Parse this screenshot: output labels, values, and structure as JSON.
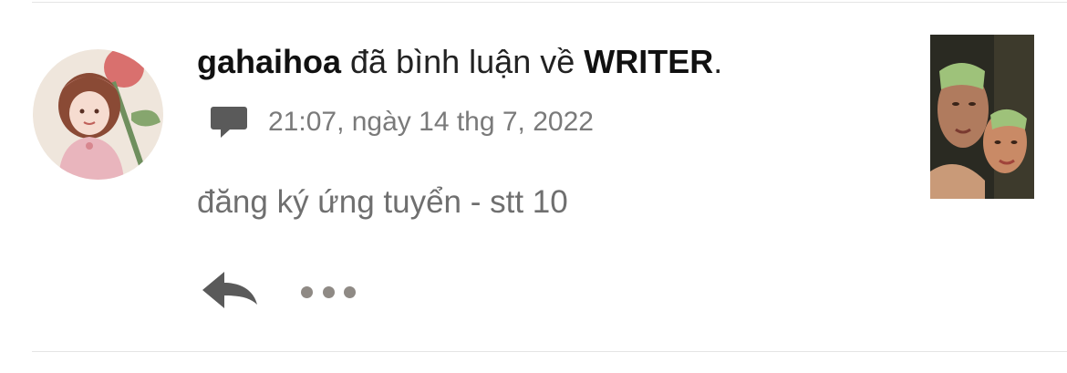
{
  "notification": {
    "username": "gahaihoa",
    "action_text": " đã bình luận về ",
    "story_title": "WRITER",
    "trailing": ".",
    "timestamp": "21:07, ngày 14 thg 7, 2022",
    "comment_text": "đăng ký ứng tuyển - stt 10"
  },
  "icons": {
    "comment": "speech-bubble-icon",
    "reply": "reply-arrow-icon",
    "more": "more-dots-icon"
  },
  "colors": {
    "meta_text": "#7a7a7a",
    "icon": "#5a5a5a",
    "dots": "#8f8a85"
  }
}
